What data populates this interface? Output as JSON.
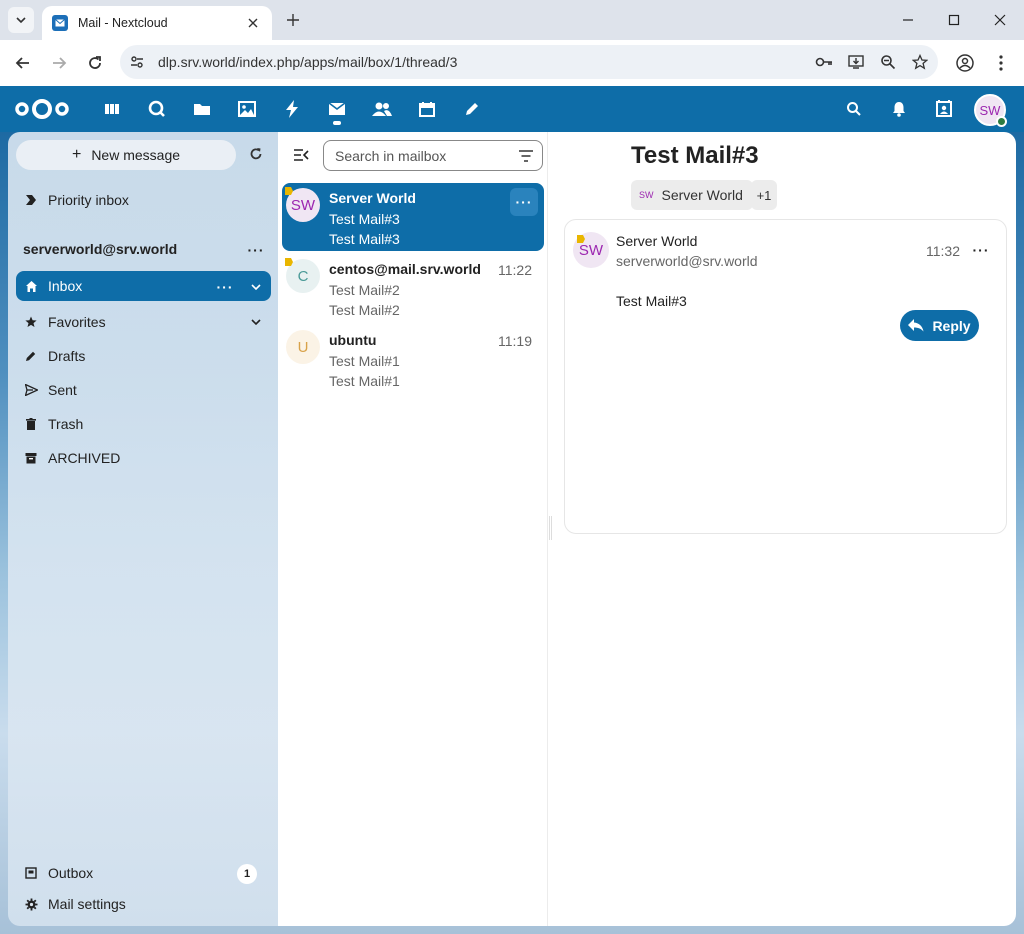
{
  "browser": {
    "tab_title": "Mail - Nextcloud",
    "url": "dlp.srv.world/index.php/apps/mail/box/1/thread/3"
  },
  "header": {
    "apps": [
      "dashboard-icon",
      "search-circle-icon",
      "folder-icon",
      "image-icon",
      "activity-icon",
      "mail-icon",
      "contacts-icon",
      "calendar-icon",
      "notes-icon"
    ],
    "avatar_initials": "SW",
    "accent": "#0e6da8"
  },
  "sidebar": {
    "new_message": "New message",
    "priority_inbox": "Priority inbox",
    "account": "serverworld@srv.world",
    "items": [
      {
        "label": "Inbox"
      },
      {
        "label": "Favorites"
      },
      {
        "label": "Drafts"
      },
      {
        "label": "Sent"
      },
      {
        "label": "Trash"
      },
      {
        "label": "ARCHIVED"
      }
    ],
    "outbox": "Outbox",
    "outbox_count": "1",
    "mail_settings": "Mail settings"
  },
  "list": {
    "search_placeholder": "Search in mailbox",
    "messages": [
      {
        "avatar": "SW",
        "from": "Server World",
        "subject": "Test Mail#3",
        "preview": "Test Mail#3",
        "time": ""
      },
      {
        "avatar": "C",
        "from": "centos@mail.srv.world",
        "subject": "Test Mail#2",
        "preview": "Test Mail#2",
        "time": "11:22"
      },
      {
        "avatar": "U",
        "from": "ubuntu",
        "subject": "Test Mail#1",
        "preview": "Test Mail#1",
        "time": "11:19"
      }
    ]
  },
  "thread": {
    "title": "Test Mail#3",
    "recipient_initials": "SW",
    "recipient": "Server World",
    "more_recipients": "+1",
    "message": {
      "avatar": "SW",
      "from": "Server World",
      "email": "serverworld@srv.world",
      "time": "11:32",
      "body": "Test Mail#3",
      "reply": "Reply"
    }
  }
}
